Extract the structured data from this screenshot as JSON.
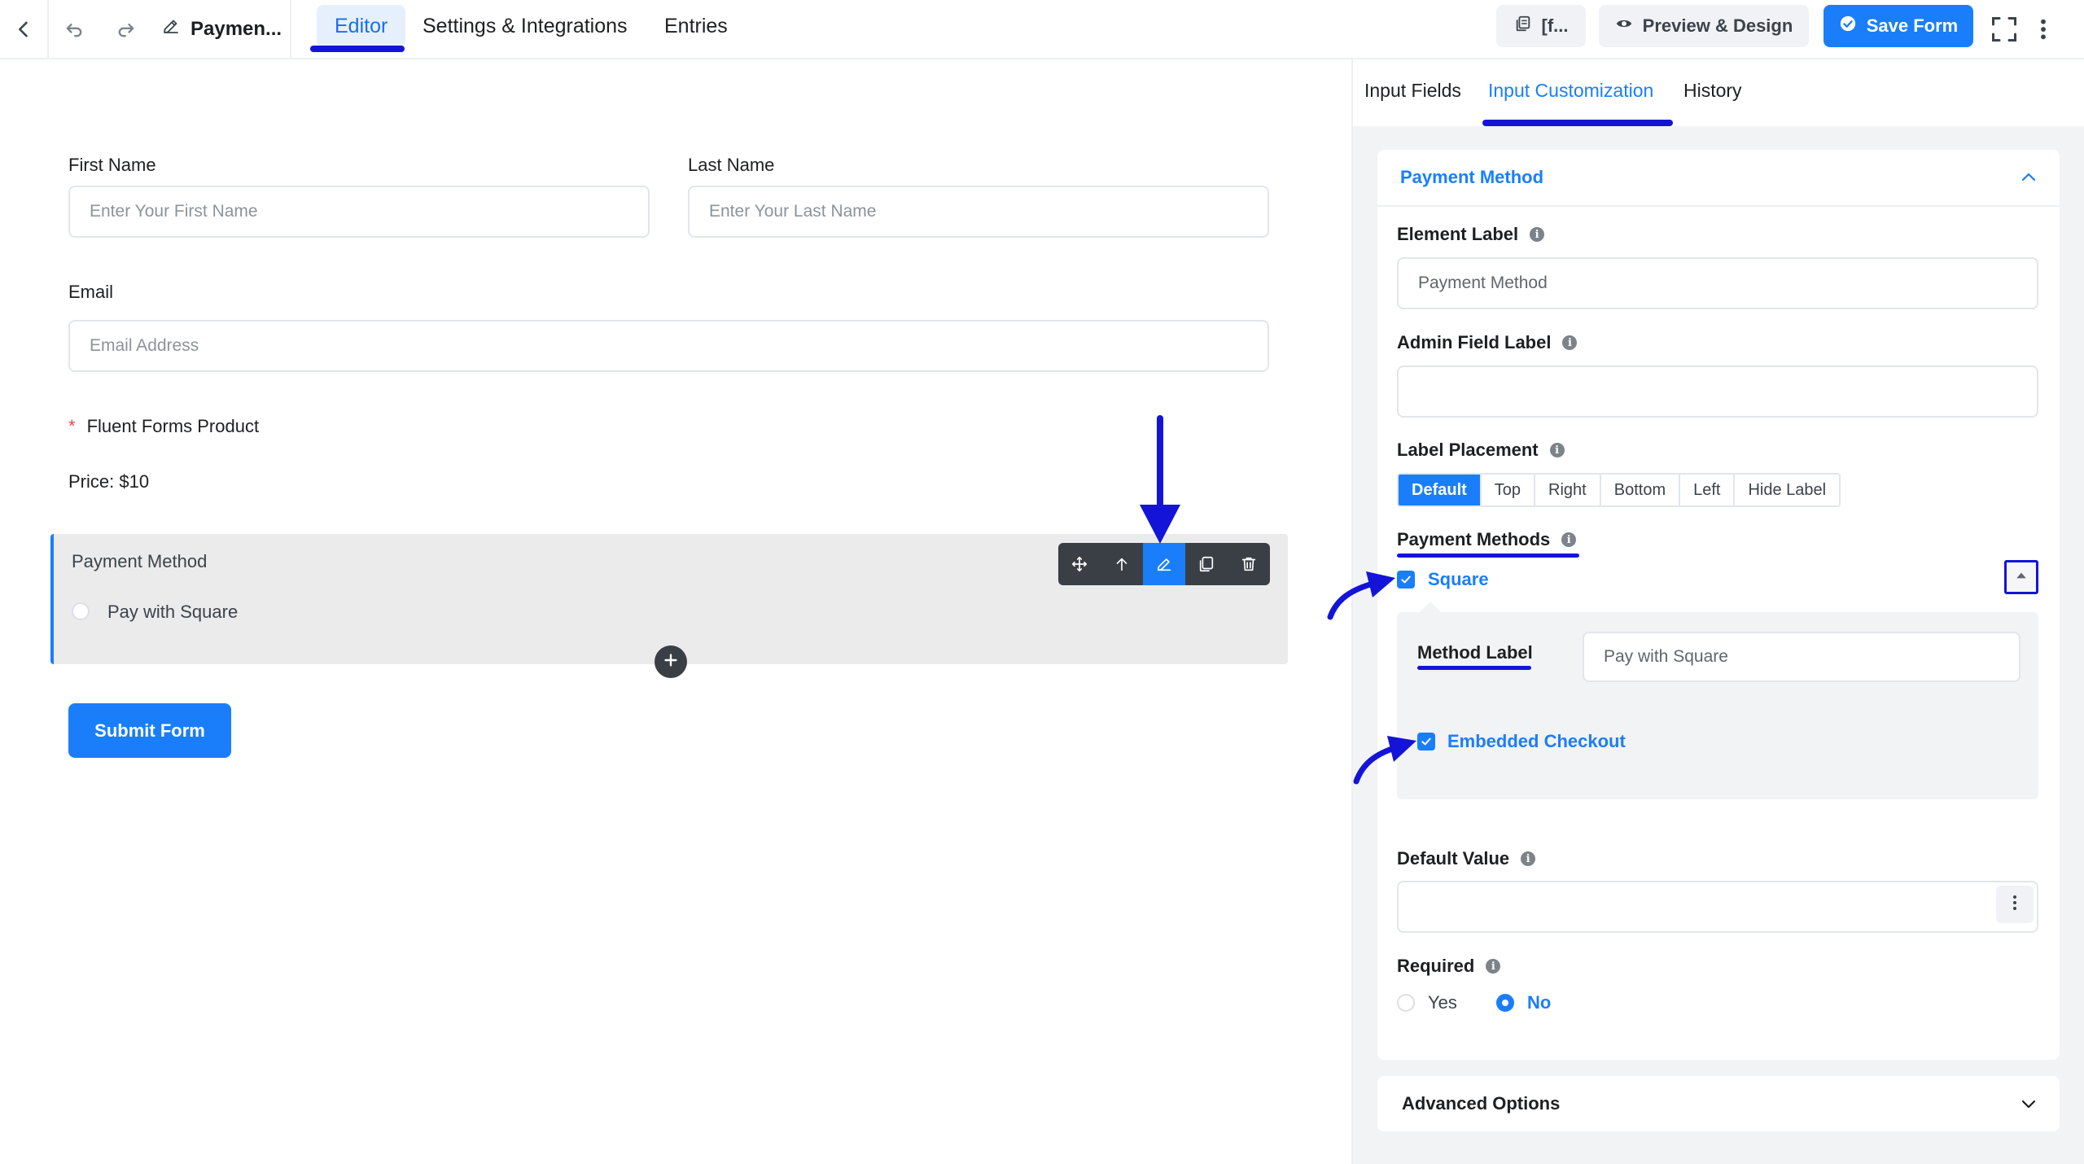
{
  "topbar": {
    "form_title": "Paymen...",
    "tabs": [
      {
        "label": "Editor",
        "active": true
      },
      {
        "label": "Settings & Integrations",
        "active": false
      },
      {
        "label": "Entries",
        "active": false
      }
    ],
    "shortcode_label": "[f...",
    "preview_label": "Preview & Design",
    "save_label": "Save Form",
    "icons": [
      "chevron-left-icon",
      "undo-icon",
      "redo-icon",
      "pencil-icon",
      "copy-icon",
      "eye-icon",
      "check-circle-icon",
      "fullscreen-icon",
      "kebab-icon"
    ]
  },
  "form": {
    "first_name": {
      "label": "First Name",
      "placeholder": "Enter Your First Name"
    },
    "last_name": {
      "label": "Last Name",
      "placeholder": "Enter Your Last Name"
    },
    "email": {
      "label": "Email",
      "placeholder": "Email Address"
    },
    "product": {
      "required_mark": "*",
      "label": "Fluent Forms Product",
      "price": "Price: $10"
    },
    "payment_method": {
      "label": "Payment Method",
      "option": "Pay with Square"
    },
    "submit_label": "Submit Form"
  },
  "panel": {
    "tabs": [
      {
        "label": "Input Fields",
        "active": false
      },
      {
        "label": "Input Customization",
        "active": true
      },
      {
        "label": "History",
        "active": false
      }
    ],
    "section_title": "Payment Method",
    "element_label": {
      "label": "Element Label",
      "value": "Payment Method"
    },
    "admin_field_label": {
      "label": "Admin Field Label",
      "value": ""
    },
    "label_placement": {
      "label": "Label Placement",
      "options": [
        "Default",
        "Top",
        "Right",
        "Bottom",
        "Left",
        "Hide Label"
      ],
      "selected": "Default"
    },
    "payment_methods": {
      "label": "Payment Methods",
      "method_name": "Square",
      "method_checked": true,
      "method_label_title": "Method Label",
      "method_label_value": "Pay with Square",
      "embedded_checkout": "Embedded Checkout",
      "embedded_checked": true
    },
    "default_value": {
      "label": "Default Value",
      "value": ""
    },
    "required": {
      "label": "Required",
      "options": [
        "Yes",
        "No"
      ],
      "selected": "No"
    },
    "advanced_options": "Advanced Options"
  },
  "colors": {
    "accent": "#1a7efb",
    "annotation": "#1414d8",
    "panel_bg": "#f2f3f5",
    "toolbar_bg": "#3a3f45"
  }
}
